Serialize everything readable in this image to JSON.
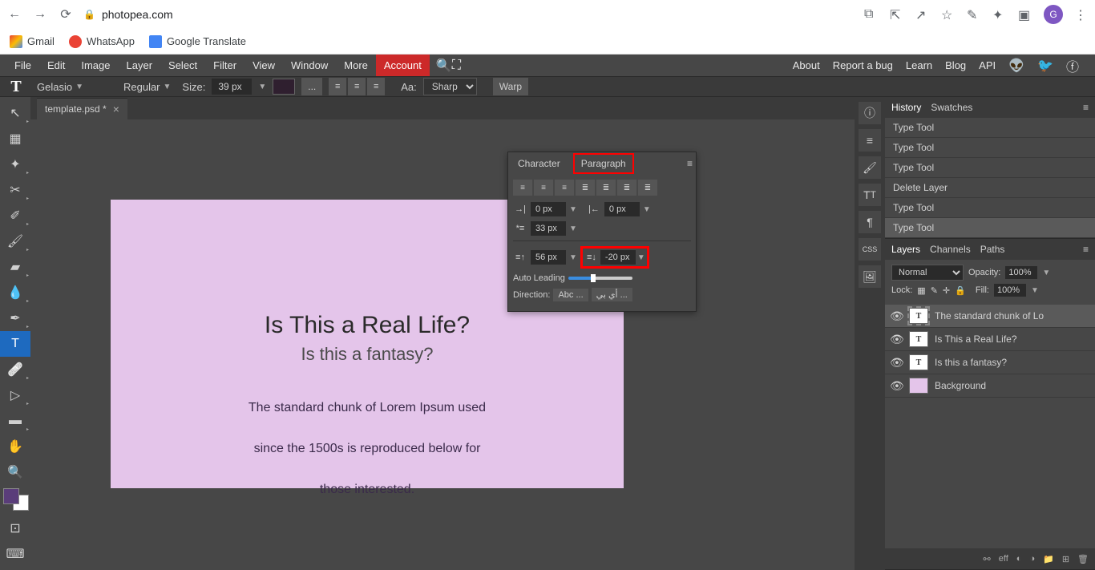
{
  "browser": {
    "url": "photopea.com",
    "profile_letter": "G"
  },
  "bookmarks": {
    "gmail": "Gmail",
    "whatsapp": "WhatsApp",
    "translate": "Google Translate"
  },
  "menubar": {
    "items": [
      "File",
      "Edit",
      "Image",
      "Layer",
      "Select",
      "Filter",
      "View",
      "Window",
      "More"
    ],
    "account": "Account",
    "right": [
      "About",
      "Report a bug",
      "Learn",
      "Blog",
      "API"
    ]
  },
  "options": {
    "font_family": "Gelasio",
    "font_style": "Regular",
    "size_label": "Size:",
    "size_value": "39 px",
    "more_btn": "...",
    "aa_label": "Aa:",
    "aa_value": "Sharp",
    "warp": "Warp"
  },
  "tab": {
    "name": "template.psd *"
  },
  "canvas": {
    "h1": "Is This a Real Life?",
    "h2": "Is this a fantasy?",
    "p1": "The standard chunk of Lorem Ipsum used",
    "p2": "since the 1500s is reproduced below for",
    "p3": "those interested."
  },
  "paragraph_panel": {
    "tab_character": "Character",
    "tab_paragraph": "Paragraph",
    "indent_left": "0 px",
    "indent_right": "0 px",
    "indent_first": "33 px",
    "space_before": "56 px",
    "space_after": "-20 px",
    "auto_leading_label": "Auto Leading",
    "direction_label": "Direction:",
    "direction_ltr": "Abc ...",
    "direction_rtl": "أي بي ..."
  },
  "history_panel": {
    "tab_history": "History",
    "tab_swatches": "Swatches",
    "items": [
      "Type Tool",
      "Type Tool",
      "Type Tool",
      "Delete Layer",
      "Type Tool",
      "Type Tool"
    ]
  },
  "layers_panel": {
    "tab_layers": "Layers",
    "tab_channels": "Channels",
    "tab_paths": "Paths",
    "blend_mode": "Normal",
    "opacity_label": "Opacity:",
    "opacity_value": "100%",
    "lock_label": "Lock:",
    "fill_label": "Fill:",
    "fill_value": "100%",
    "layers": [
      {
        "name": "The standard chunk of Lo",
        "type": "T",
        "selected": true
      },
      {
        "name": "Is This a Real Life?",
        "type": "T",
        "selected": false
      },
      {
        "name": "Is this a fantasy?",
        "type": "T",
        "selected": false
      },
      {
        "name": "Background",
        "type": "bg",
        "selected": false
      }
    ],
    "footer_eff": "eff"
  }
}
